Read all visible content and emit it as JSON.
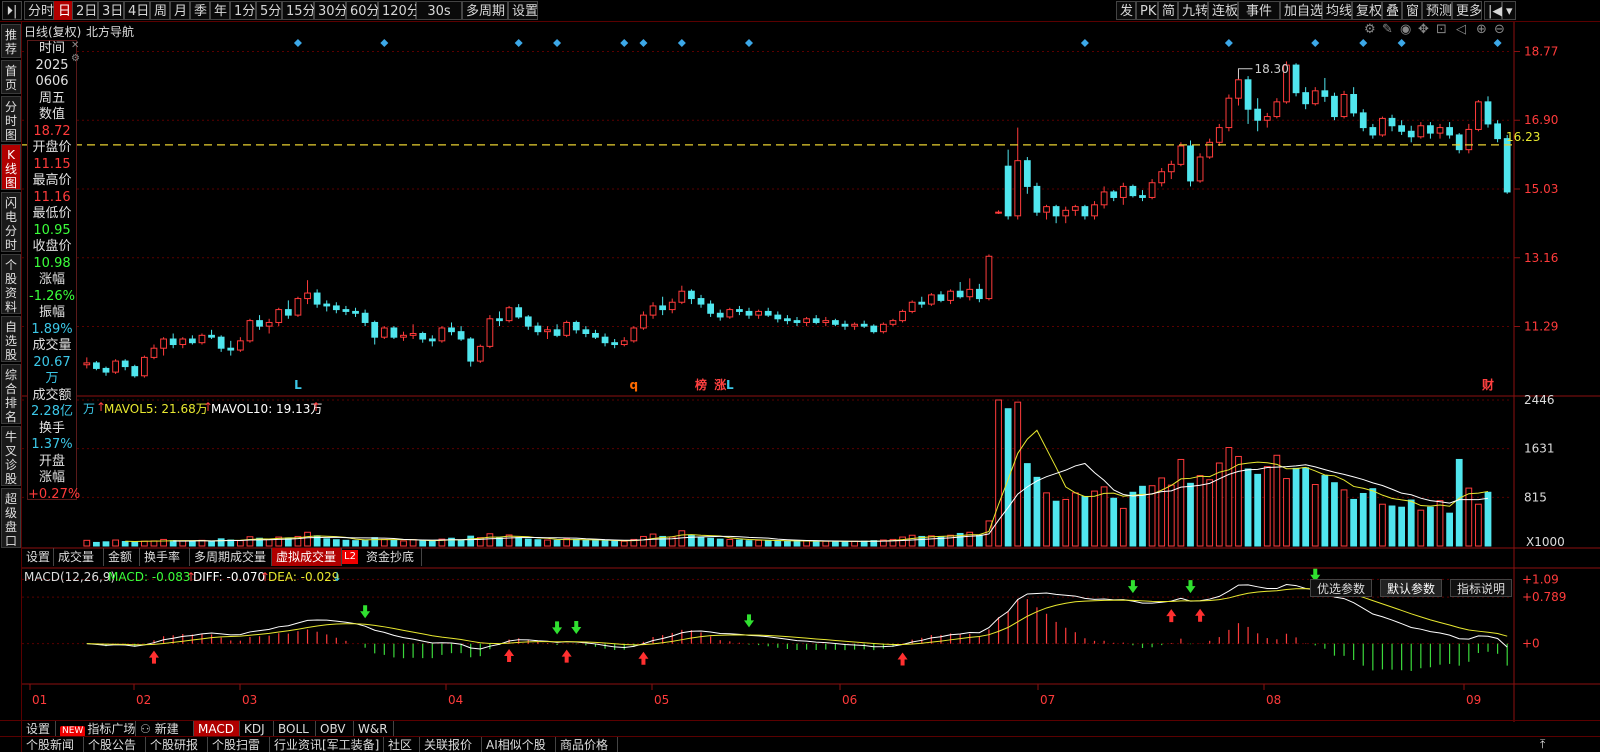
{
  "topbar": {
    "left": [
      {
        "label": "分时",
        "w": 30
      },
      {
        "label": "日",
        "w": 18,
        "active": true
      },
      {
        "label": "2日",
        "w": 26
      },
      {
        "label": "3日",
        "w": 26
      },
      {
        "label": "4日",
        "w": 26
      },
      {
        "label": "周",
        "w": 20
      },
      {
        "label": "月",
        "w": 20
      },
      {
        "label": "季",
        "w": 20
      },
      {
        "label": "年",
        "w": 20
      },
      {
        "label": "1分",
        "w": 26
      },
      {
        "label": "5分",
        "w": 26
      },
      {
        "label": "15分",
        "w": 32
      },
      {
        "label": "30分",
        "w": 32
      },
      {
        "label": "60分",
        "w": 32
      },
      {
        "label": "120分",
        "w": 38
      },
      {
        "label": "30s",
        "w": 46
      },
      {
        "label": "多周期",
        "w": 46
      },
      {
        "label": "设置",
        "w": 30
      }
    ],
    "right": [
      {
        "label": "发",
        "w": 20
      },
      {
        "label": "PK",
        "w": 22
      },
      {
        "label": "简",
        "w": 20
      },
      {
        "label": "九转",
        "w": 30
      },
      {
        "label": "连板",
        "w": 30
      },
      {
        "label": "事件",
        "w": 42
      },
      {
        "label": "加自选",
        "w": 42
      },
      {
        "label": "均线",
        "w": 30
      },
      {
        "label": "复权",
        "w": 30
      },
      {
        "label": "叠",
        "w": 20
      },
      {
        "label": "窗",
        "w": 20
      },
      {
        "label": "预测",
        "w": 30
      },
      {
        "label": "更多",
        "w": 30
      }
    ]
  },
  "left_tabs": [
    {
      "label": "推荐",
      "h": 36
    },
    {
      "label": "首页",
      "h": 36
    },
    {
      "label": "分时图",
      "h": 48
    },
    {
      "label": "K线图",
      "h": 48,
      "active": true
    },
    {
      "label": "闪电分时",
      "h": 62
    },
    {
      "label": "个股资料",
      "h": 62
    },
    {
      "label": "自选股",
      "h": 48
    },
    {
      "label": "综合排名",
      "h": 62
    },
    {
      "label": "牛叉诊股",
      "h": 62
    },
    {
      "label": "超级盘口",
      "h": 62
    }
  ],
  "chart_header": {
    "title": "日线(复权)",
    "stock": "北方导航"
  },
  "info_panel": [
    {
      "t": "时间",
      "c": "k"
    },
    {
      "t": "2025",
      "c": "k"
    },
    {
      "t": "0606",
      "c": "k"
    },
    {
      "t": "周五",
      "c": "k"
    },
    {
      "t": "数值",
      "c": "k"
    },
    {
      "t": "18.72",
      "c": "r"
    },
    {
      "t": "开盘价",
      "c": "k"
    },
    {
      "t": "11.15",
      "c": "r"
    },
    {
      "t": "最高价",
      "c": "k"
    },
    {
      "t": "11.16",
      "c": "r"
    },
    {
      "t": "最低价",
      "c": "k"
    },
    {
      "t": "10.95",
      "c": "g"
    },
    {
      "t": "收盘价",
      "c": "k"
    },
    {
      "t": "10.98",
      "c": "g"
    },
    {
      "t": "涨幅",
      "c": "k"
    },
    {
      "t": "-1.26%",
      "c": "g"
    },
    {
      "t": "振幅",
      "c": "k"
    },
    {
      "t": "1.89%",
      "c": "c"
    },
    {
      "t": "成交量",
      "c": "k"
    },
    {
      "t": "20.67万",
      "c": "c"
    },
    {
      "t": "成交额",
      "c": "k"
    },
    {
      "t": "2.28亿",
      "c": "c"
    },
    {
      "t": "换手",
      "c": "k"
    },
    {
      "t": "1.37%",
      "c": "c"
    },
    {
      "t": "开盘",
      "c": "k"
    },
    {
      "t": "涨幅",
      "c": "k"
    },
    {
      "t": "+0.27%",
      "c": "r"
    }
  ],
  "price_axis": [
    "18.77",
    "16.90",
    "15.03",
    "13.16",
    "11.29"
  ],
  "price_markers": {
    "high": "18.30",
    "current": "16.23"
  },
  "events": [
    {
      "label": "L",
      "color": "#3cc8e8"
    },
    {
      "label": "q",
      "color": "#ff6a00"
    },
    {
      "label": "榜",
      "color": "#ff4040"
    },
    {
      "label": "涨",
      "color": "#ff4040"
    },
    {
      "label": "L",
      "color": "#3cc8e8"
    },
    {
      "label": "财",
      "color": "#ff4040"
    }
  ],
  "volume_header": {
    "unit": "万",
    "mavol5": "MAVOL5: 21.68万",
    "mavol10": "MAVOL10: 19.13万"
  },
  "volume_axis": [
    "2446",
    "1631",
    "815",
    "X1000"
  ],
  "sub_tabs": [
    {
      "label": "设置",
      "w": 32
    },
    {
      "label": "成交量",
      "w": 50
    },
    {
      "label": "金额",
      "w": 36
    },
    {
      "label": "换手率",
      "w": 50
    },
    {
      "label": "多周期成交量",
      "w": 82
    },
    {
      "label": "虚拟成交量",
      "w": 70,
      "active": true
    },
    {
      "label": "L2",
      "w": 16
    },
    {
      "label": "资金抄底",
      "w": 60
    }
  ],
  "macd_header": {
    "name": "MACD(12,26,9)",
    "macd": "MACD: -0.083",
    "diff": "DIFF: -0.070",
    "dea": "DEA: -0.029"
  },
  "macd_axis": [
    "+1.09",
    "+0.789",
    "+0"
  ],
  "param_tabs": [
    {
      "label": "优选参数"
    },
    {
      "label": "默认参数",
      "active": true
    },
    {
      "label": "指标说明"
    }
  ],
  "x_axis": [
    "01",
    "02",
    "03",
    "04",
    "05",
    "06",
    "07",
    "08",
    "09"
  ],
  "bottom_tabs": [
    {
      "label": "设置",
      "w": 34
    },
    {
      "label": "指标广场",
      "w": 80,
      "badge": "NEW"
    },
    {
      "label": "新建",
      "w": 58
    },
    {
      "label": "MACD",
      "w": 46,
      "active": true
    },
    {
      "label": "KDJ",
      "w": 34
    },
    {
      "label": "BOLL",
      "w": 42
    },
    {
      "label": "OBV",
      "w": 38
    },
    {
      "label": "W&R",
      "w": 40
    }
  ],
  "news_tabs": [
    {
      "label": "个股新闻",
      "w": 62
    },
    {
      "label": "个股公告",
      "w": 62
    },
    {
      "label": "个股研报",
      "w": 62
    },
    {
      "label": "个股扫雷",
      "w": 62
    },
    {
      "label": "行业资讯[军工装备]",
      "w": 114
    },
    {
      "label": "社区",
      "w": 36
    },
    {
      "label": "关联报价",
      "w": 62
    },
    {
      "label": "AI相似个股",
      "w": 74
    },
    {
      "label": "商品价格",
      "w": 62
    }
  ],
  "chart_data": {
    "type": "candlestick",
    "price_range": [
      9.4,
      19.3
    ],
    "candles": [
      [
        10.25,
        10.45,
        10.15,
        10.3
      ],
      [
        10.3,
        10.35,
        10.1,
        10.15
      ],
      [
        10.15,
        10.2,
        9.95,
        10.05
      ],
      [
        10.05,
        10.4,
        10.0,
        10.35
      ],
      [
        10.35,
        10.4,
        10.1,
        10.2
      ],
      [
        10.2,
        10.25,
        9.9,
        9.95
      ],
      [
        9.95,
        10.5,
        9.9,
        10.45
      ],
      [
        10.45,
        10.8,
        10.4,
        10.7
      ],
      [
        10.7,
        11.0,
        10.5,
        10.95
      ],
      [
        10.95,
        11.1,
        10.7,
        10.8
      ],
      [
        10.8,
        11.0,
        10.7,
        10.95
      ],
      [
        10.95,
        11.05,
        10.8,
        10.85
      ],
      [
        10.85,
        11.1,
        10.8,
        11.05
      ],
      [
        11.05,
        11.2,
        10.95,
        11.0
      ],
      [
        11.0,
        11.05,
        10.6,
        10.7
      ],
      [
        10.7,
        10.9,
        10.5,
        10.65
      ],
      [
        10.65,
        11.0,
        10.6,
        10.9
      ],
      [
        10.9,
        11.5,
        10.85,
        11.45
      ],
      [
        11.45,
        11.6,
        11.2,
        11.3
      ],
      [
        11.3,
        11.5,
        11.1,
        11.4
      ],
      [
        11.4,
        11.8,
        11.3,
        11.75
      ],
      [
        11.75,
        12.0,
        11.5,
        11.6
      ],
      [
        11.6,
        12.1,
        11.55,
        12.05
      ],
      [
        12.05,
        12.55,
        11.9,
        12.2
      ],
      [
        12.2,
        12.3,
        11.8,
        11.9
      ],
      [
        11.9,
        12.0,
        11.7,
        11.85
      ],
      [
        11.85,
        11.95,
        11.65,
        11.75
      ],
      [
        11.75,
        11.85,
        11.6,
        11.7
      ],
      [
        11.7,
        11.8,
        11.55,
        11.65
      ],
      [
        11.65,
        11.75,
        11.3,
        11.4
      ],
      [
        11.4,
        11.45,
        10.8,
        11.0
      ],
      [
        11.0,
        11.3,
        10.95,
        11.25
      ],
      [
        11.25,
        11.3,
        10.95,
        11.0
      ],
      [
        11.0,
        11.15,
        10.9,
        11.05
      ],
      [
        11.05,
        11.35,
        10.95,
        11.1
      ],
      [
        11.1,
        11.15,
        10.85,
        10.95
      ],
      [
        10.95,
        11.05,
        10.75,
        10.9
      ],
      [
        10.9,
        11.3,
        10.85,
        11.25
      ],
      [
        11.25,
        11.4,
        11.05,
        11.15
      ],
      [
        11.15,
        11.3,
        10.9,
        10.95
      ],
      [
        10.95,
        11.0,
        10.2,
        10.35
      ],
      [
        10.35,
        10.8,
        10.3,
        10.75
      ],
      [
        10.75,
        11.6,
        10.7,
        11.5
      ],
      [
        11.5,
        11.7,
        11.3,
        11.45
      ],
      [
        11.45,
        11.85,
        11.4,
        11.8
      ],
      [
        11.8,
        11.9,
        11.5,
        11.55
      ],
      [
        11.55,
        11.6,
        11.2,
        11.3
      ],
      [
        11.3,
        11.4,
        11.05,
        11.15
      ],
      [
        11.15,
        11.3,
        10.95,
        11.2
      ],
      [
        11.2,
        11.35,
        11.0,
        11.05
      ],
      [
        11.05,
        11.45,
        11.0,
        11.4
      ],
      [
        11.4,
        11.45,
        11.1,
        11.2
      ],
      [
        11.2,
        11.3,
        11.0,
        11.1
      ],
      [
        11.1,
        11.2,
        10.95,
        11.0
      ],
      [
        11.0,
        11.1,
        10.75,
        10.85
      ],
      [
        10.85,
        10.95,
        10.7,
        10.8
      ],
      [
        10.8,
        11.0,
        10.75,
        10.9
      ],
      [
        10.9,
        11.3,
        10.85,
        11.25
      ],
      [
        11.25,
        11.7,
        11.2,
        11.6
      ],
      [
        11.6,
        11.95,
        11.5,
        11.85
      ],
      [
        11.85,
        12.1,
        11.6,
        11.75
      ],
      [
        11.75,
        12.05,
        11.65,
        11.95
      ],
      [
        11.95,
        12.4,
        11.9,
        12.25
      ],
      [
        12.25,
        12.3,
        11.9,
        12.05
      ],
      [
        12.05,
        12.15,
        11.8,
        11.9
      ],
      [
        11.9,
        12.0,
        11.55,
        11.65
      ],
      [
        11.65,
        11.75,
        11.45,
        11.55
      ],
      [
        11.55,
        11.8,
        11.5,
        11.75
      ],
      [
        11.75,
        11.85,
        11.6,
        11.7
      ],
      [
        11.7,
        11.8,
        11.5,
        11.6
      ],
      [
        11.6,
        11.75,
        11.5,
        11.7
      ],
      [
        11.7,
        11.8,
        11.55,
        11.6
      ],
      [
        11.6,
        11.7,
        11.4,
        11.5
      ],
      [
        11.5,
        11.6,
        11.35,
        11.45
      ],
      [
        11.45,
        11.55,
        11.3,
        11.4
      ],
      [
        11.4,
        11.55,
        11.3,
        11.5
      ],
      [
        11.5,
        11.6,
        11.35,
        11.4
      ],
      [
        11.4,
        11.55,
        11.3,
        11.45
      ],
      [
        11.45,
        11.5,
        11.3,
        11.35
      ],
      [
        11.35,
        11.45,
        11.2,
        11.3
      ],
      [
        11.3,
        11.4,
        11.2,
        11.35
      ],
      [
        11.35,
        11.45,
        11.25,
        11.3
      ],
      [
        11.3,
        11.35,
        11.1,
        11.15
      ],
      [
        11.15,
        11.4,
        11.1,
        11.35
      ],
      [
        11.35,
        11.5,
        11.3,
        11.45
      ],
      [
        11.45,
        11.75,
        11.4,
        11.7
      ],
      [
        11.7,
        12.0,
        11.65,
        11.95
      ],
      [
        11.95,
        12.1,
        11.8,
        11.9
      ],
      [
        11.9,
        12.2,
        11.85,
        12.15
      ],
      [
        12.15,
        12.25,
        11.95,
        12.0
      ],
      [
        12.0,
        12.3,
        11.9,
        12.25
      ],
      [
        12.25,
        12.5,
        12.05,
        12.1
      ],
      [
        12.1,
        12.6,
        12.0,
        12.3
      ],
      [
        12.3,
        12.45,
        11.95,
        12.05
      ],
      [
        12.05,
        13.25,
        12.0,
        13.2
      ],
      [
        14.4,
        14.45,
        14.35,
        14.4
      ],
      [
        15.65,
        16.1,
        14.2,
        14.3
      ],
      [
        14.3,
        16.7,
        14.2,
        15.8
      ],
      [
        15.8,
        15.9,
        14.9,
        15.1
      ],
      [
        15.1,
        15.2,
        14.3,
        14.4
      ],
      [
        14.4,
        14.6,
        14.2,
        14.55
      ],
      [
        14.55,
        14.6,
        14.1,
        14.3
      ],
      [
        14.3,
        14.55,
        14.1,
        14.45
      ],
      [
        14.45,
        14.6,
        14.3,
        14.55
      ],
      [
        14.55,
        14.6,
        14.2,
        14.3
      ],
      [
        14.3,
        14.7,
        14.2,
        14.6
      ],
      [
        14.6,
        15.1,
        14.5,
        14.95
      ],
      [
        14.95,
        15.0,
        14.7,
        14.8
      ],
      [
        14.8,
        15.2,
        14.6,
        15.1
      ],
      [
        15.1,
        15.15,
        14.8,
        14.85
      ],
      [
        14.85,
        15.0,
        14.7,
        14.8
      ],
      [
        14.8,
        15.3,
        14.75,
        15.2
      ],
      [
        15.2,
        15.6,
        15.1,
        15.5
      ],
      [
        15.5,
        15.8,
        15.3,
        15.7
      ],
      [
        15.7,
        16.3,
        15.65,
        16.2
      ],
      [
        16.2,
        16.35,
        15.1,
        15.25
      ],
      [
        15.25,
        16.0,
        15.2,
        15.9
      ],
      [
        15.9,
        16.4,
        15.85,
        16.3
      ],
      [
        16.3,
        16.8,
        16.2,
        16.7
      ],
      [
        16.7,
        17.6,
        16.6,
        17.5
      ],
      [
        17.5,
        18.3,
        17.3,
        18.0
      ],
      [
        18.0,
        18.1,
        16.8,
        17.2
      ],
      [
        17.2,
        17.5,
        16.6,
        16.9
      ],
      [
        16.9,
        17.1,
        16.7,
        17.0
      ],
      [
        17.0,
        17.5,
        16.95,
        17.4
      ],
      [
        17.4,
        18.5,
        17.35,
        18.4
      ],
      [
        18.4,
        18.45,
        17.55,
        17.65
      ],
      [
        17.65,
        17.8,
        17.2,
        17.35
      ],
      [
        17.35,
        17.8,
        17.3,
        17.7
      ],
      [
        17.7,
        18.05,
        17.4,
        17.55
      ],
      [
        17.55,
        17.65,
        16.9,
        17.0
      ],
      [
        17.0,
        17.7,
        16.95,
        17.6
      ],
      [
        17.6,
        17.8,
        17.0,
        17.1
      ],
      [
        17.1,
        17.2,
        16.6,
        16.7
      ],
      [
        16.7,
        16.8,
        16.4,
        16.5
      ],
      [
        16.5,
        17.0,
        16.45,
        16.95
      ],
      [
        16.95,
        17.05,
        16.6,
        16.75
      ],
      [
        16.75,
        16.9,
        16.5,
        16.6
      ],
      [
        16.6,
        16.75,
        16.3,
        16.45
      ],
      [
        16.45,
        16.85,
        16.4,
        16.75
      ],
      [
        16.75,
        16.85,
        16.4,
        16.55
      ],
      [
        16.55,
        16.8,
        16.4,
        16.7
      ],
      [
        16.7,
        16.85,
        16.4,
        16.5
      ],
      [
        16.5,
        16.55,
        16.0,
        16.1
      ],
      [
        16.1,
        16.8,
        16.0,
        16.65
      ],
      [
        16.65,
        17.45,
        16.6,
        17.4
      ],
      [
        17.4,
        17.55,
        16.7,
        16.8
      ],
      [
        16.8,
        16.9,
        16.3,
        16.4
      ],
      [
        16.4,
        16.5,
        14.9,
        14.95
      ]
    ],
    "volume": [
      0.95,
      0.6,
      0.7,
      1.0,
      0.75,
      0.7,
      0.8,
      0.85,
      1.1,
      0.9,
      0.85,
      0.8,
      0.95,
      0.75,
      1.2,
      1.0,
      0.9,
      1.55,
      1.3,
      1.1,
      1.5,
      1.35,
      1.6,
      2.3,
      1.7,
      1.2,
      1.05,
      0.95,
      0.9,
      1.0,
      1.4,
      1.1,
      0.95,
      0.85,
      1.05,
      0.9,
      0.8,
      1.15,
      1.3,
      1.0,
      1.65,
      1.4,
      2.05,
      1.35,
      1.85,
      1.4,
      1.15,
      1.05,
      1.0,
      0.95,
      1.2,
      1.1,
      1.0,
      0.9,
      0.85,
      0.8,
      0.8,
      1.1,
      1.6,
      2.0,
      1.6,
      1.5,
      2.55,
      1.85,
      1.5,
      1.3,
      1.15,
      1.1,
      1.0,
      0.9,
      0.95,
      0.9,
      0.85,
      0.8,
      0.8,
      0.85,
      0.8,
      0.8,
      0.75,
      0.7,
      0.8,
      0.8,
      0.9,
      1.0,
      1.1,
      1.5,
      1.8,
      1.6,
      1.7,
      1.5,
      1.8,
      2.1,
      2.3,
      1.8,
      4.2,
      24.46,
      23.0,
      24.1,
      13.8,
      11.5,
      8.9,
      7.5,
      7.8,
      8.9,
      8.3,
      9.2,
      9.9,
      8.0,
      6.3,
      9.0,
      10.0,
      10.1,
      11.4,
      10.2,
      14.5,
      10.5,
      11.8,
      11.1,
      13.9,
      16.5,
      15.0,
      12.9,
      12.0,
      13.3,
      15.2,
      11.3,
      13.0,
      13.1,
      10.3,
      11.8,
      10.6,
      9.4,
      7.8,
      8.8,
      9.6,
      7.0,
      6.7,
      6.5,
      7.7,
      6.0,
      6.5,
      7.6,
      5.5,
      14.5,
      9.7,
      7.0,
      9.0
    ],
    "macd_range": [
      -0.65,
      1.25
    ]
  }
}
